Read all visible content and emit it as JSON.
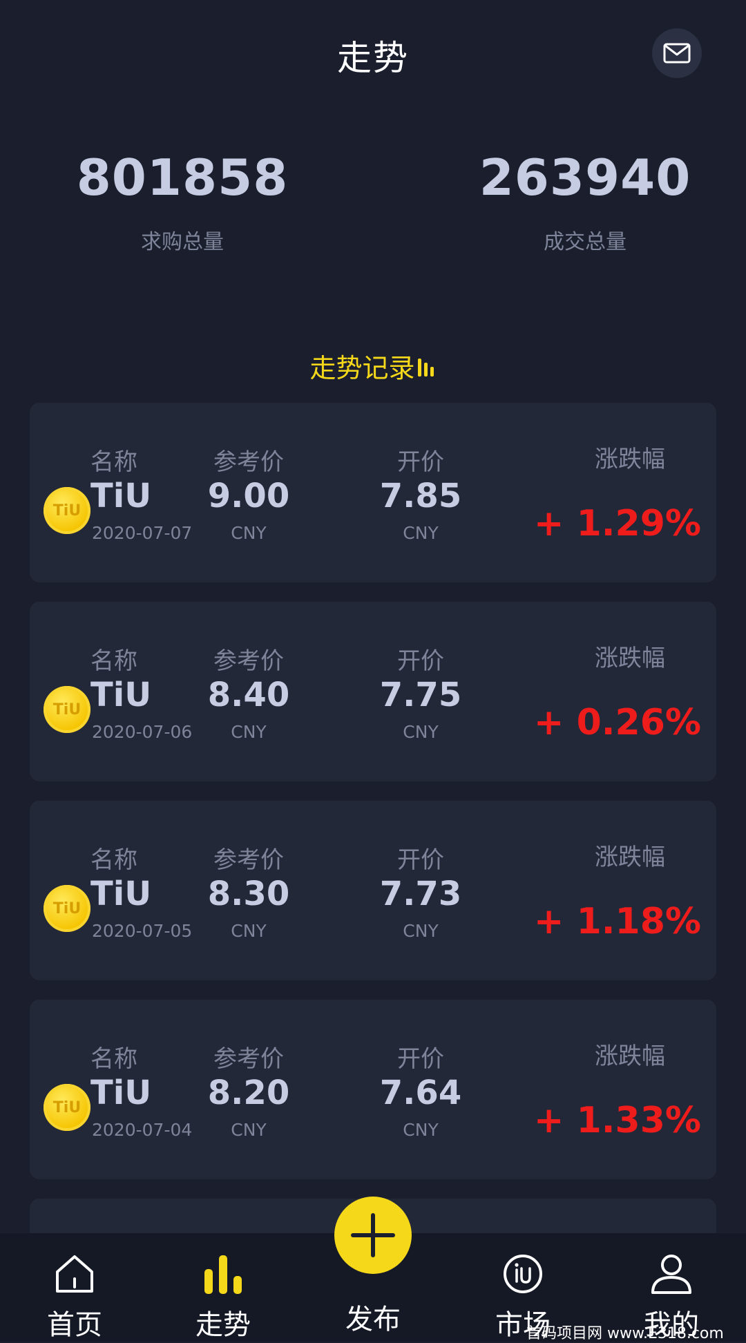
{
  "header": {
    "title": "走势"
  },
  "stats": {
    "left": {
      "value": "801858",
      "label": "求购总量"
    },
    "right": {
      "value": "263940",
      "label": "成交总量"
    }
  },
  "section": {
    "title": "走势记录"
  },
  "labels": {
    "name": "名称",
    "ref_price": "参考价",
    "open_price": "开价",
    "change": "涨跌幅"
  },
  "records": [
    {
      "coin_icon_text": "TiU",
      "name": "TiU",
      "date": "2020-07-07",
      "ref_price": "9.00",
      "ref_unit": "CNY",
      "open_price": "7.85",
      "open_unit": "CNY",
      "change": "+ 1.29%"
    },
    {
      "coin_icon_text": "TiU",
      "name": "TiU",
      "date": "2020-07-06",
      "ref_price": "8.40",
      "ref_unit": "CNY",
      "open_price": "7.75",
      "open_unit": "CNY",
      "change": "+ 0.26%"
    },
    {
      "coin_icon_text": "TiU",
      "name": "TiU",
      "date": "2020-07-05",
      "ref_price": "8.30",
      "ref_unit": "CNY",
      "open_price": "7.73",
      "open_unit": "CNY",
      "change": "+ 1.18%"
    },
    {
      "coin_icon_text": "TiU",
      "name": "TiU",
      "date": "2020-07-04",
      "ref_price": "8.20",
      "ref_unit": "CNY",
      "open_price": "7.64",
      "open_unit": "CNY",
      "change": "+ 1.33%"
    }
  ],
  "tabbar": {
    "home": "首页",
    "trend": "走势",
    "publish": "发布",
    "market": "市场",
    "mine": "我的"
  },
  "watermark": "首码项目网 www.E318.com",
  "colors": {
    "background": "#1b1f2d",
    "card": "#232839",
    "accent": "#f6d81b",
    "up": "#ef1c1c"
  },
  "icons": {
    "mail": "mail-icon",
    "home": "home-icon",
    "trend": "bar-chart-icon",
    "publish": "plus-icon",
    "market": "market-icon",
    "mine": "user-icon"
  }
}
